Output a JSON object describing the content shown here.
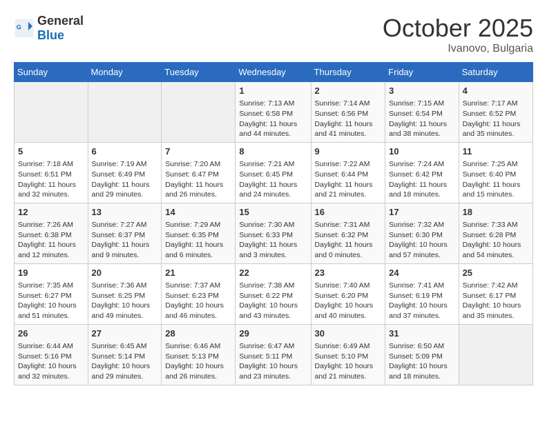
{
  "header": {
    "logo_general": "General",
    "logo_blue": "Blue",
    "month_title": "October 2025",
    "location": "Ivanovo, Bulgaria"
  },
  "days_of_week": [
    "Sunday",
    "Monday",
    "Tuesday",
    "Wednesday",
    "Thursday",
    "Friday",
    "Saturday"
  ],
  "weeks": [
    [
      {
        "day": "",
        "content": ""
      },
      {
        "day": "",
        "content": ""
      },
      {
        "day": "",
        "content": ""
      },
      {
        "day": "1",
        "content": "Sunrise: 7:13 AM\nSunset: 6:58 PM\nDaylight: 11 hours and 44 minutes."
      },
      {
        "day": "2",
        "content": "Sunrise: 7:14 AM\nSunset: 6:56 PM\nDaylight: 11 hours and 41 minutes."
      },
      {
        "day": "3",
        "content": "Sunrise: 7:15 AM\nSunset: 6:54 PM\nDaylight: 11 hours and 38 minutes."
      },
      {
        "day": "4",
        "content": "Sunrise: 7:17 AM\nSunset: 6:52 PM\nDaylight: 11 hours and 35 minutes."
      }
    ],
    [
      {
        "day": "5",
        "content": "Sunrise: 7:18 AM\nSunset: 6:51 PM\nDaylight: 11 hours and 32 minutes."
      },
      {
        "day": "6",
        "content": "Sunrise: 7:19 AM\nSunset: 6:49 PM\nDaylight: 11 hours and 29 minutes."
      },
      {
        "day": "7",
        "content": "Sunrise: 7:20 AM\nSunset: 6:47 PM\nDaylight: 11 hours and 26 minutes."
      },
      {
        "day": "8",
        "content": "Sunrise: 7:21 AM\nSunset: 6:45 PM\nDaylight: 11 hours and 24 minutes."
      },
      {
        "day": "9",
        "content": "Sunrise: 7:22 AM\nSunset: 6:44 PM\nDaylight: 11 hours and 21 minutes."
      },
      {
        "day": "10",
        "content": "Sunrise: 7:24 AM\nSunset: 6:42 PM\nDaylight: 11 hours and 18 minutes."
      },
      {
        "day": "11",
        "content": "Sunrise: 7:25 AM\nSunset: 6:40 PM\nDaylight: 11 hours and 15 minutes."
      }
    ],
    [
      {
        "day": "12",
        "content": "Sunrise: 7:26 AM\nSunset: 6:38 PM\nDaylight: 11 hours and 12 minutes."
      },
      {
        "day": "13",
        "content": "Sunrise: 7:27 AM\nSunset: 6:37 PM\nDaylight: 11 hours and 9 minutes."
      },
      {
        "day": "14",
        "content": "Sunrise: 7:29 AM\nSunset: 6:35 PM\nDaylight: 11 hours and 6 minutes."
      },
      {
        "day": "15",
        "content": "Sunrise: 7:30 AM\nSunset: 6:33 PM\nDaylight: 11 hours and 3 minutes."
      },
      {
        "day": "16",
        "content": "Sunrise: 7:31 AM\nSunset: 6:32 PM\nDaylight: 11 hours and 0 minutes."
      },
      {
        "day": "17",
        "content": "Sunrise: 7:32 AM\nSunset: 6:30 PM\nDaylight: 10 hours and 57 minutes."
      },
      {
        "day": "18",
        "content": "Sunrise: 7:33 AM\nSunset: 6:28 PM\nDaylight: 10 hours and 54 minutes."
      }
    ],
    [
      {
        "day": "19",
        "content": "Sunrise: 7:35 AM\nSunset: 6:27 PM\nDaylight: 10 hours and 51 minutes."
      },
      {
        "day": "20",
        "content": "Sunrise: 7:36 AM\nSunset: 6:25 PM\nDaylight: 10 hours and 49 minutes."
      },
      {
        "day": "21",
        "content": "Sunrise: 7:37 AM\nSunset: 6:23 PM\nDaylight: 10 hours and 46 minutes."
      },
      {
        "day": "22",
        "content": "Sunrise: 7:38 AM\nSunset: 6:22 PM\nDaylight: 10 hours and 43 minutes."
      },
      {
        "day": "23",
        "content": "Sunrise: 7:40 AM\nSunset: 6:20 PM\nDaylight: 10 hours and 40 minutes."
      },
      {
        "day": "24",
        "content": "Sunrise: 7:41 AM\nSunset: 6:19 PM\nDaylight: 10 hours and 37 minutes."
      },
      {
        "day": "25",
        "content": "Sunrise: 7:42 AM\nSunset: 6:17 PM\nDaylight: 10 hours and 35 minutes."
      }
    ],
    [
      {
        "day": "26",
        "content": "Sunrise: 6:44 AM\nSunset: 5:16 PM\nDaylight: 10 hours and 32 minutes."
      },
      {
        "day": "27",
        "content": "Sunrise: 6:45 AM\nSunset: 5:14 PM\nDaylight: 10 hours and 29 minutes."
      },
      {
        "day": "28",
        "content": "Sunrise: 6:46 AM\nSunset: 5:13 PM\nDaylight: 10 hours and 26 minutes."
      },
      {
        "day": "29",
        "content": "Sunrise: 6:47 AM\nSunset: 5:11 PM\nDaylight: 10 hours and 23 minutes."
      },
      {
        "day": "30",
        "content": "Sunrise: 6:49 AM\nSunset: 5:10 PM\nDaylight: 10 hours and 21 minutes."
      },
      {
        "day": "31",
        "content": "Sunrise: 6:50 AM\nSunset: 5:09 PM\nDaylight: 10 hours and 18 minutes."
      },
      {
        "day": "",
        "content": ""
      }
    ]
  ]
}
